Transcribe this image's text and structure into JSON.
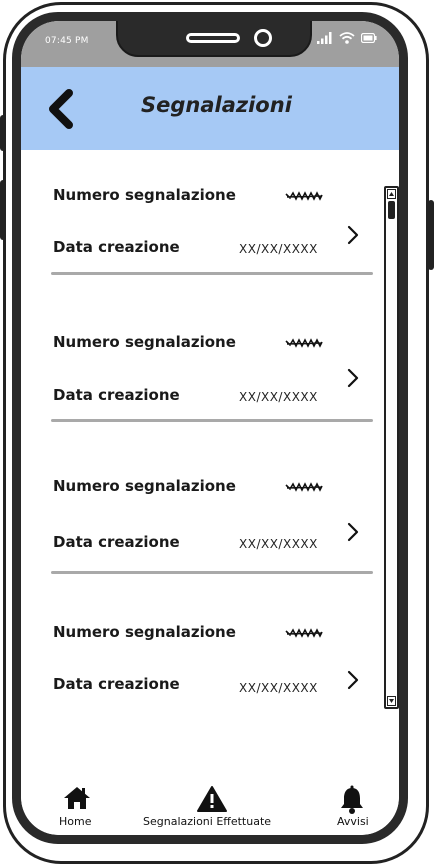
{
  "status_bar": {
    "time": "07:45 PM"
  },
  "app_bar": {
    "title": "Segnalazioni",
    "back_icon": "chevron-left-icon"
  },
  "reports": [
    {
      "number_label": "Numero segnalazione",
      "date_label": "Data creazione",
      "date_value": "XX/XX/XXXX"
    },
    {
      "number_label": "Numero segnalazione",
      "date_label": "Data creazione",
      "date_value": "XX/XX/XXXX"
    },
    {
      "number_label": "Numero segnalazione",
      "date_label": "Data creazione",
      "date_value": "XX/XX/XXXX"
    },
    {
      "number_label": "Numero segnalazione",
      "date_label": "Data creazione",
      "date_value": "XX/XX/XXXX"
    }
  ],
  "bottom_nav": {
    "items": [
      {
        "label": "Home",
        "icon": "home-icon"
      },
      {
        "label": "Segnalazioni Effettuate",
        "icon": "warning-icon"
      },
      {
        "label": "Avvisi",
        "icon": "bell-icon"
      }
    ]
  },
  "colors": {
    "app_bar": "#a6c9f5",
    "status_bar": "#9f9f9f",
    "divider": "#a9a9a9",
    "frame": "#2a2a2a"
  }
}
